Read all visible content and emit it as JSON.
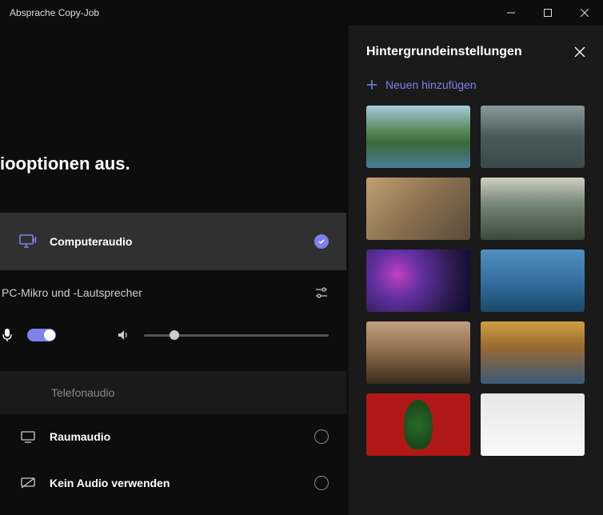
{
  "window": {
    "title": "Absprache Copy-Job"
  },
  "left": {
    "heading": "iooptionen aus.",
    "computer_audio": "Computeraudio",
    "device": "PC-Mikro und -Lautsprecher",
    "phone_audio": "Telefonaudio",
    "room_audio": "Raumaudio",
    "no_audio": "Kein Audio verwenden"
  },
  "right": {
    "title": "Hintergrundeinstellungen",
    "add_new": "Neuen hinzufügen"
  }
}
